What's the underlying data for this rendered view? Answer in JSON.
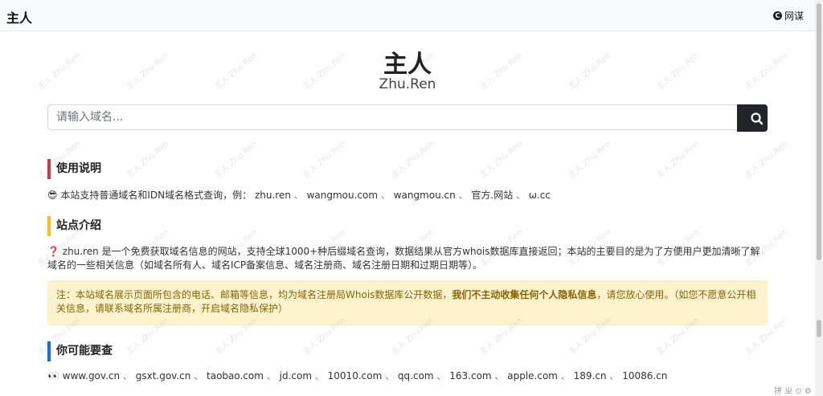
{
  "header": {
    "brand": "主人",
    "nav_link_label": "网谋",
    "nav_link_icon": "c-circle-icon"
  },
  "hero": {
    "title": "主人",
    "subtitle": "Zhu.Ren"
  },
  "search": {
    "placeholder": "请输入域名...",
    "button_icon": "search-icon"
  },
  "usage": {
    "heading": "使用说明",
    "intro_emoji": "😎",
    "intro": "本站支持普通域名和IDN域名格式查询，例：",
    "examples": [
      "zhu.ren",
      "wangmou.com",
      "wangmou.cn",
      "官方.网站",
      "ω.cc"
    ],
    "separator": "、"
  },
  "about": {
    "heading": "站点介绍",
    "emoji": "❓",
    "text": "zhu.ren 是一个免费获取域名信息的网站，支持全球1000+种后缀域名查询，数据结果从官方whois数据库直接返回；本站的主要目的是为了方便用户更加清晰了解域名的一些相关信息（如域名所有人、域名ICP备案信息、域名注册商、域名注册日期和过期日期等）。"
  },
  "notice": {
    "prefix": "注：本站域名展示页面所包含的电话、邮箱等信息，均为域名注册局Whois数据库公开数据，",
    "bold": "我们不主动收集任何个人隐私信息",
    "suffix": "，请您放心使用。（如您不愿意公开相关信息，请联系域名所属注册商，开启域名隐私保护）"
  },
  "maybe": {
    "heading": "你可能要查",
    "emoji": "👀",
    "domains": [
      "www.gov.cn",
      "gsxt.gov.cn",
      "taobao.com",
      "jd.com",
      "10010.com",
      "qq.com",
      "163.com",
      "apple.com",
      "189.cn",
      "10086.cn"
    ]
  },
  "watermark": "主人 Zhu.Ren",
  "ime_hint": "拼 ㄓ ⊙ ⚙",
  "colors": {
    "usage_bar": "#dc3545",
    "about_bar": "#ffc107",
    "maybe_bar": "#0d6efd",
    "alert_bg": "#fff3cd",
    "alert_text": "#856404",
    "search_button": "#212529"
  }
}
